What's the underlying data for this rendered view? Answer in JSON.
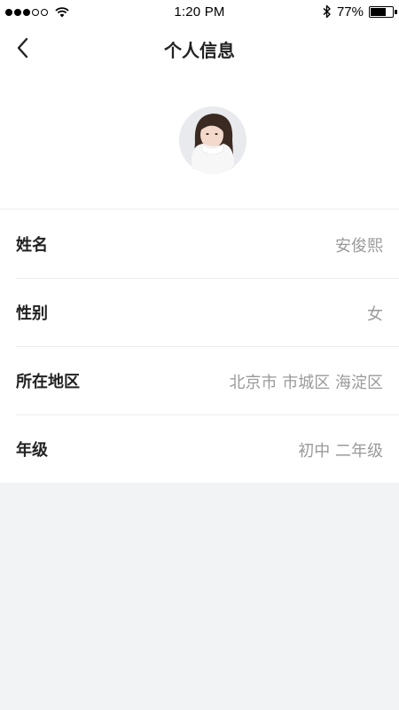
{
  "status_bar": {
    "time": "1:20 PM",
    "battery_percent": "77%",
    "battery_level": 0.77,
    "signal_dots_filled": 3,
    "signal_dots_total": 5
  },
  "nav": {
    "title": "个人信息",
    "back_icon": "chevron-left-icon"
  },
  "profile": {
    "avatar_icon": "user-avatar"
  },
  "info_rows": [
    {
      "label": "姓名",
      "value": "安俊熙"
    },
    {
      "label": "性别",
      "value": "女"
    },
    {
      "label": "所在地区",
      "value": "北京市 市城区 海淀区"
    },
    {
      "label": "年级",
      "value": "初中 二年级"
    }
  ],
  "colors": {
    "background": "#f2f3f5",
    "label": "#222222",
    "value": "#9a9a9a",
    "divider": "#ececec"
  }
}
